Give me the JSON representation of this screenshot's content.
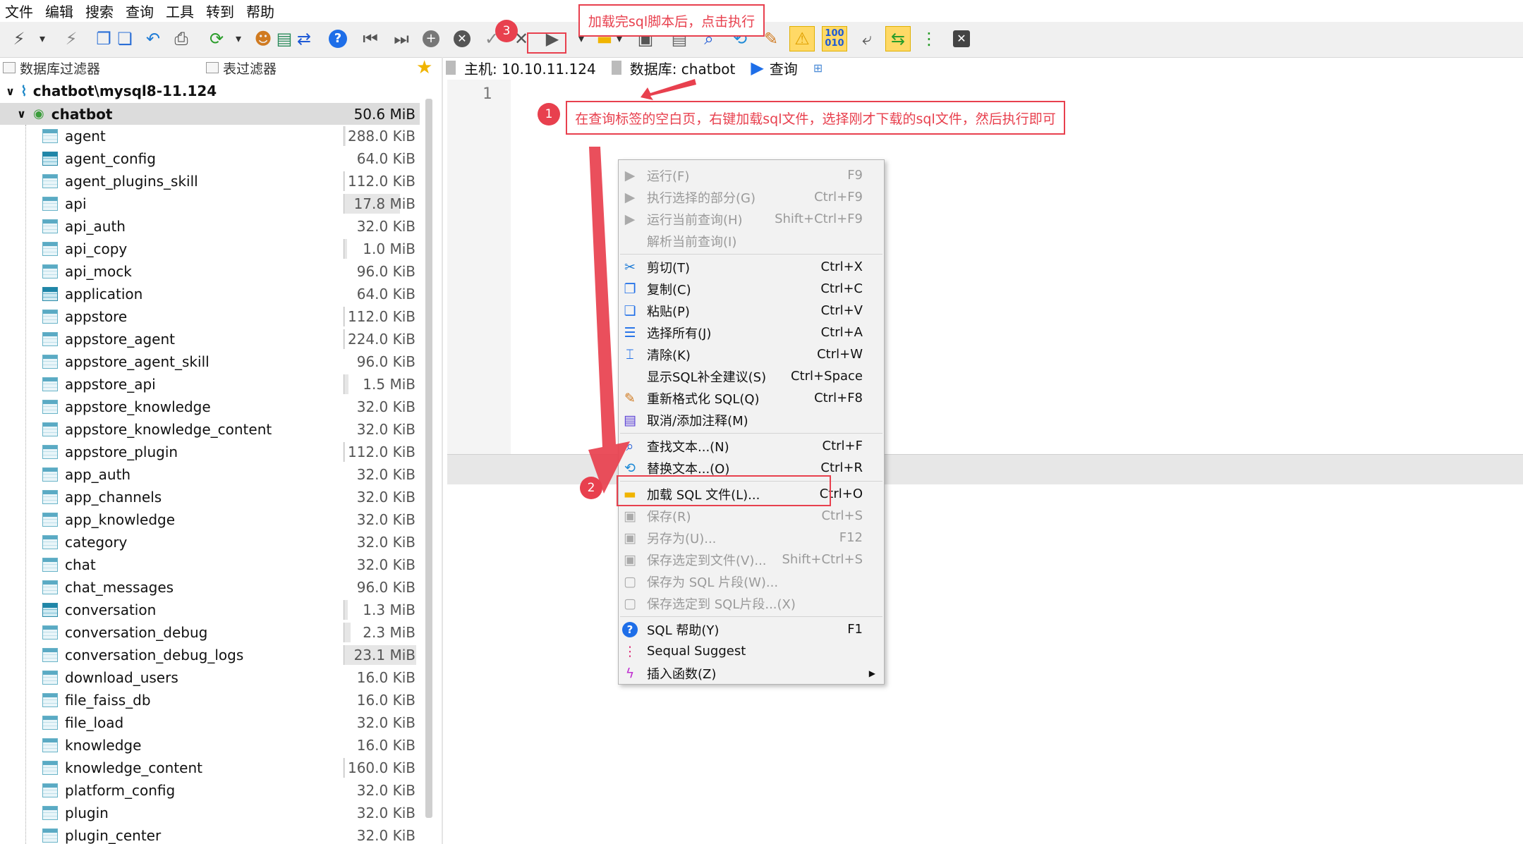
{
  "menubar": [
    "文件",
    "编辑",
    "搜索",
    "查询",
    "工具",
    "转到",
    "帮助"
  ],
  "toolbar": {
    "icons": [
      "connect-icon",
      "dropdown-arrow-icon",
      "disconnect-icon",
      "copy-table-icon",
      "paste-table-icon",
      "undo-icon",
      "print-icon",
      "refresh-icon",
      "dropdown-arrow-icon",
      "user-manager-icon",
      "export-csv-icon",
      "transfer-icon",
      "help-icon",
      "first-record-icon",
      "last-record-icon",
      "add-record-icon",
      "delete-record-icon",
      "confirm-icon",
      "cancel-icon",
      "execute-icon",
      "dropdown-arrow-icon",
      "open-folder-icon",
      "dropdown-arrow-icon",
      "save-icon",
      "save-as-icon",
      "find-icon",
      "replace-icon",
      "format-sql-icon",
      "warnings-icon",
      "binary-icon",
      "wordwrap-icon",
      "sync-icon",
      "more-icon",
      "close-tab-icon"
    ]
  },
  "filters": {
    "db_filter": "数据库过滤器",
    "table_filter": "表过滤器"
  },
  "tree": {
    "root": "chatbot\\mysql8-11.124",
    "db": {
      "name": "chatbot",
      "size": "50.6 MiB"
    },
    "tables": [
      {
        "name": "agent",
        "size": "288.0 KiB",
        "bar": 0.02
      },
      {
        "name": "agent_config",
        "size": "64.0 KiB",
        "bar": 0,
        "bold": true
      },
      {
        "name": "agent_plugins_skill",
        "size": "112.0 KiB",
        "bar": 0.01
      },
      {
        "name": "api",
        "size": "17.8 MiB",
        "bar": 0.77
      },
      {
        "name": "api_auth",
        "size": "32.0 KiB",
        "bar": 0
      },
      {
        "name": "api_copy",
        "size": "1.0 MiB",
        "bar": 0.04
      },
      {
        "name": "api_mock",
        "size": "96.0 KiB",
        "bar": 0
      },
      {
        "name": "application",
        "size": "64.0 KiB",
        "bar": 0,
        "bold": true
      },
      {
        "name": "appstore",
        "size": "112.0 KiB",
        "bar": 0.01
      },
      {
        "name": "appstore_agent",
        "size": "224.0 KiB",
        "bar": 0.01
      },
      {
        "name": "appstore_agent_skill",
        "size": "96.0 KiB",
        "bar": 0
      },
      {
        "name": "appstore_api",
        "size": "1.5 MiB",
        "bar": 0.06
      },
      {
        "name": "appstore_knowledge",
        "size": "32.0 KiB",
        "bar": 0
      },
      {
        "name": "appstore_knowledge_content",
        "size": "32.0 KiB",
        "bar": 0
      },
      {
        "name": "appstore_plugin",
        "size": "112.0 KiB",
        "bar": 0.01
      },
      {
        "name": "app_auth",
        "size": "32.0 KiB",
        "bar": 0
      },
      {
        "name": "app_channels",
        "size": "32.0 KiB",
        "bar": 0
      },
      {
        "name": "app_knowledge",
        "size": "32.0 KiB",
        "bar": 0
      },
      {
        "name": "category",
        "size": "32.0 KiB",
        "bar": 0
      },
      {
        "name": "chat",
        "size": "32.0 KiB",
        "bar": 0
      },
      {
        "name": "chat_messages",
        "size": "96.0 KiB",
        "bar": 0
      },
      {
        "name": "conversation",
        "size": "1.3 MiB",
        "bar": 0.05,
        "bold": true
      },
      {
        "name": "conversation_debug",
        "size": "2.3 MiB",
        "bar": 0.09
      },
      {
        "name": "conversation_debug_logs",
        "size": "23.1 MiB",
        "bar": 1.0
      },
      {
        "name": "download_users",
        "size": "16.0 KiB",
        "bar": 0
      },
      {
        "name": "file_faiss_db",
        "size": "16.0 KiB",
        "bar": 0
      },
      {
        "name": "file_load",
        "size": "32.0 KiB",
        "bar": 0
      },
      {
        "name": "knowledge",
        "size": "16.0 KiB",
        "bar": 0
      },
      {
        "name": "knowledge_content",
        "size": "160.0 KiB",
        "bar": 0.01
      },
      {
        "name": "platform_config",
        "size": "32.0 KiB",
        "bar": 0
      },
      {
        "name": "plugin",
        "size": "32.0 KiB",
        "bar": 0
      },
      {
        "name": "plugin_center",
        "size": "32.0 KiB",
        "bar": 0
      }
    ]
  },
  "connection": {
    "host": "主机: 10.10.11.124",
    "database": "数据库: chatbot",
    "query_tab": "查询"
  },
  "editor": {
    "line_number": "1"
  },
  "context_menu": [
    {
      "label": "运行(F)",
      "shortcut": "F9",
      "disabled": true,
      "icon": "run-icon"
    },
    {
      "label": "执行选择的部分(G)",
      "shortcut": "Ctrl+F9",
      "disabled": true,
      "icon": "run-selection-icon"
    },
    {
      "label": "运行当前查询(H)",
      "shortcut": "Shift+Ctrl+F9",
      "disabled": true,
      "icon": "run-current-icon"
    },
    {
      "label": "解析当前查询(I)",
      "shortcut": "",
      "disabled": true,
      "icon": ""
    },
    {
      "sep": true
    },
    {
      "label": "剪切(T)",
      "shortcut": "Ctrl+X",
      "icon": "cut-icon"
    },
    {
      "label": "复制(C)",
      "shortcut": "Ctrl+C",
      "icon": "copy-icon"
    },
    {
      "label": "粘贴(P)",
      "shortcut": "Ctrl+V",
      "icon": "paste-icon"
    },
    {
      "label": "选择所有(J)",
      "shortcut": "Ctrl+A",
      "icon": "select-all-icon"
    },
    {
      "label": "清除(K)",
      "shortcut": "Ctrl+W",
      "icon": "clear-icon"
    },
    {
      "label": "显示SQL补全建议(S)",
      "shortcut": "Ctrl+Space",
      "icon": ""
    },
    {
      "label": "重新格式化 SQL(Q)",
      "shortcut": "Ctrl+F8",
      "icon": "format-sql-icon"
    },
    {
      "label": "取消/添加注释(M)",
      "shortcut": "",
      "icon": "comment-icon"
    },
    {
      "sep": true
    },
    {
      "label": "查找文本...(N)",
      "shortcut": "Ctrl+F",
      "icon": "find-icon"
    },
    {
      "label": "替换文本...(O)",
      "shortcut": "Ctrl+R",
      "icon": "replace-icon"
    },
    {
      "sep": true
    },
    {
      "label": "加载 SQL 文件(L)...",
      "shortcut": "Ctrl+O",
      "icon": "folder-icon"
    },
    {
      "label": "保存(R)",
      "shortcut": "Ctrl+S",
      "disabled": true,
      "icon": "save-icon"
    },
    {
      "label": "另存为(U)...",
      "shortcut": "F12",
      "disabled": true,
      "icon": "save-as-icon"
    },
    {
      "label": "保存选定到文件(V)...",
      "shortcut": "Shift+Ctrl+S",
      "disabled": true,
      "icon": "save-selection-icon"
    },
    {
      "label": "保存为 SQL 片段(W)...",
      "shortcut": "",
      "disabled": true,
      "icon": "snippet-icon"
    },
    {
      "label": "保存选定到 SQL片段...(X)",
      "shortcut": "",
      "disabled": true,
      "icon": "snippet-selection-icon"
    },
    {
      "sep": true
    },
    {
      "label": "SQL 帮助(Y)",
      "shortcut": "F1",
      "icon": "help-icon"
    },
    {
      "label": "Sequal Suggest",
      "shortcut": "",
      "icon": "suggest-icon"
    },
    {
      "label": "插入函数(Z)",
      "shortcut": "",
      "icon": "function-icon",
      "submenu": true
    }
  ],
  "annotations": {
    "a1": {
      "badge": "1",
      "text": "在查询标签的空白页，右键加载sql文件，选择刚才下载的sql文件，然后执行即可"
    },
    "a2": {
      "badge": "2"
    },
    "a3": {
      "badge": "3",
      "text": "加载完sql脚本后，点击执行"
    }
  },
  "colors": {
    "annotation": "#e8404e",
    "accent_blue": "#1e6ee8",
    "toolbar_highlight": "#ffd966"
  }
}
